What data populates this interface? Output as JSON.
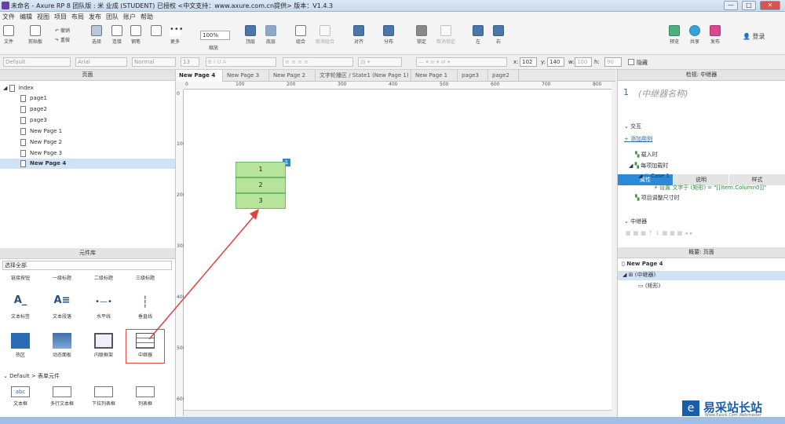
{
  "window": {
    "title": "未命名 - Axure RP 8 团队版 : 米 业成 (STUDENT) 已授权    <中文支持：www.axure.com.cn提供> 版本：V1.4.3",
    "controls": [
      "—",
      "□",
      "✕"
    ]
  },
  "menu": [
    "文件",
    "编辑",
    "视图",
    "项目",
    "布局",
    "发布",
    "团队",
    "账户",
    "帮助"
  ],
  "toolbar": {
    "file": "文件",
    "clipboard": "剪贴板",
    "undo": "撤销",
    "redo": "重做",
    "select": "选择",
    "connect": "连接",
    "pen": "钢笔",
    "more": "更多",
    "zoom_value": "100%",
    "zoom": "缩放",
    "top": "顶层",
    "bottom": "底层",
    "group": "组合",
    "ungroup": "取消组合",
    "align": "对齐",
    "distribute": "分布",
    "lock": "锁定",
    "unlock": "取消锁定",
    "left": "左",
    "right": "右",
    "preview": "预览",
    "share": "共享",
    "publish": "发布",
    "login": "登录"
  },
  "format": {
    "style": "Default",
    "font": "Arial",
    "weight": "Normal",
    "size": "13",
    "x_label": "x:",
    "x": "102",
    "y_label": "y:",
    "y": "140",
    "w_label": "w:",
    "w": "100",
    "h_label": "h:",
    "h": "90",
    "hidden": "隐藏"
  },
  "pages_panel": {
    "title": "页面",
    "root": "index",
    "pages": [
      "page1",
      "page2",
      "page3",
      "New Page 1",
      "New Page 2",
      "New Page 3",
      "New Page 4"
    ],
    "selected": "New Page 4"
  },
  "library_panel": {
    "title": "元件库",
    "filter": "选择全部",
    "row0": [
      "链接按钮",
      "一级标题",
      "二级标题",
      "三级标题"
    ],
    "row1": [
      "文本标签",
      "文本段落",
      "水平线",
      "垂直线"
    ],
    "row2": [
      "热区",
      "动态面板",
      "内联框架",
      "中继器"
    ],
    "section": "Default > 表单元件",
    "row3": [
      "文本框",
      "多行文本框",
      "下拉列表框",
      "列表框"
    ]
  },
  "tabs": [
    "New Page 4",
    "New Page 3",
    "New Page 2",
    "文字轮播区 / State1 (New Page 1)",
    "New Page 1",
    "page3",
    "page2"
  ],
  "ruler": {
    "h": [
      "0",
      "100",
      "200",
      "300",
      "400",
      "500",
      "600",
      "700",
      "800"
    ],
    "v": [
      "0",
      "100",
      "200",
      "300",
      "400",
      "500",
      "600"
    ]
  },
  "repeater": {
    "badge": "1",
    "rows": [
      "1",
      "2",
      "3"
    ]
  },
  "inspector": {
    "title": "检视: 中继器",
    "index": "1",
    "name_placeholder": "(中继器名称)",
    "tabs": [
      "属性",
      "说明",
      "样式"
    ],
    "interaction": "交互",
    "add_case": "添加用例",
    "events": {
      "load": "载入时",
      "item_load": "每项加载时",
      "case": "Case 1",
      "action": "设置 文字于 (矩形) = \"[[Item.Column0]]\"",
      "resize": "项目调整尺寸时"
    },
    "repeater_section": "中继器"
  },
  "outline_panel": {
    "title": "概要: 页面",
    "page": "New Page 4",
    "node": "(中继器)",
    "child": "(矩形)"
  },
  "watermark": {
    "text": "易采站长站",
    "sub": "Www.Easck.Com  Webmaster"
  }
}
